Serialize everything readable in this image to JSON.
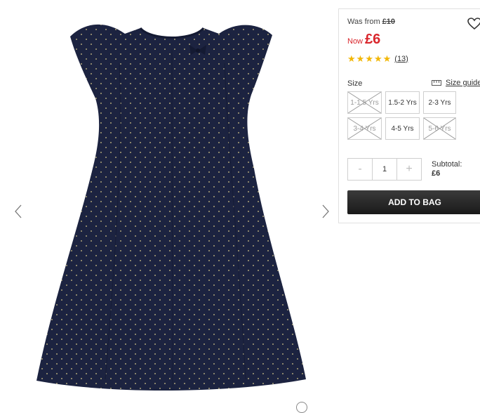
{
  "product": {
    "was_label": "Was from",
    "was_price": "£10",
    "now_label": "Now",
    "now_price": "£6",
    "rating": 5,
    "rating_max": 5,
    "review_count": "(13)"
  },
  "size": {
    "label": "Size",
    "guide_label": "Size guide",
    "options": [
      {
        "label": "1-1.5 Yrs",
        "available": false
      },
      {
        "label": "1.5-2 Yrs",
        "available": true
      },
      {
        "label": "2-3 Yrs",
        "available": true
      },
      {
        "label": "3-4 Yrs",
        "available": false
      },
      {
        "label": "4-5 Yrs",
        "available": true
      },
      {
        "label": "5-6 Yrs",
        "available": false
      }
    ]
  },
  "quantity": {
    "minus": "-",
    "value": "1",
    "plus": "+"
  },
  "subtotal": {
    "label": "Subtotal:",
    "amount": "£6"
  },
  "add_to_bag_label": "ADD TO BAG",
  "colors": {
    "sale_red": "#d9262c",
    "star_gold": "#f2b705",
    "dress_navy": "#1c2340",
    "button_dark": "#222222"
  },
  "icons": [
    "chevron-left-icon",
    "chevron-right-icon",
    "heart-icon",
    "star-icon",
    "ruler-icon"
  ]
}
